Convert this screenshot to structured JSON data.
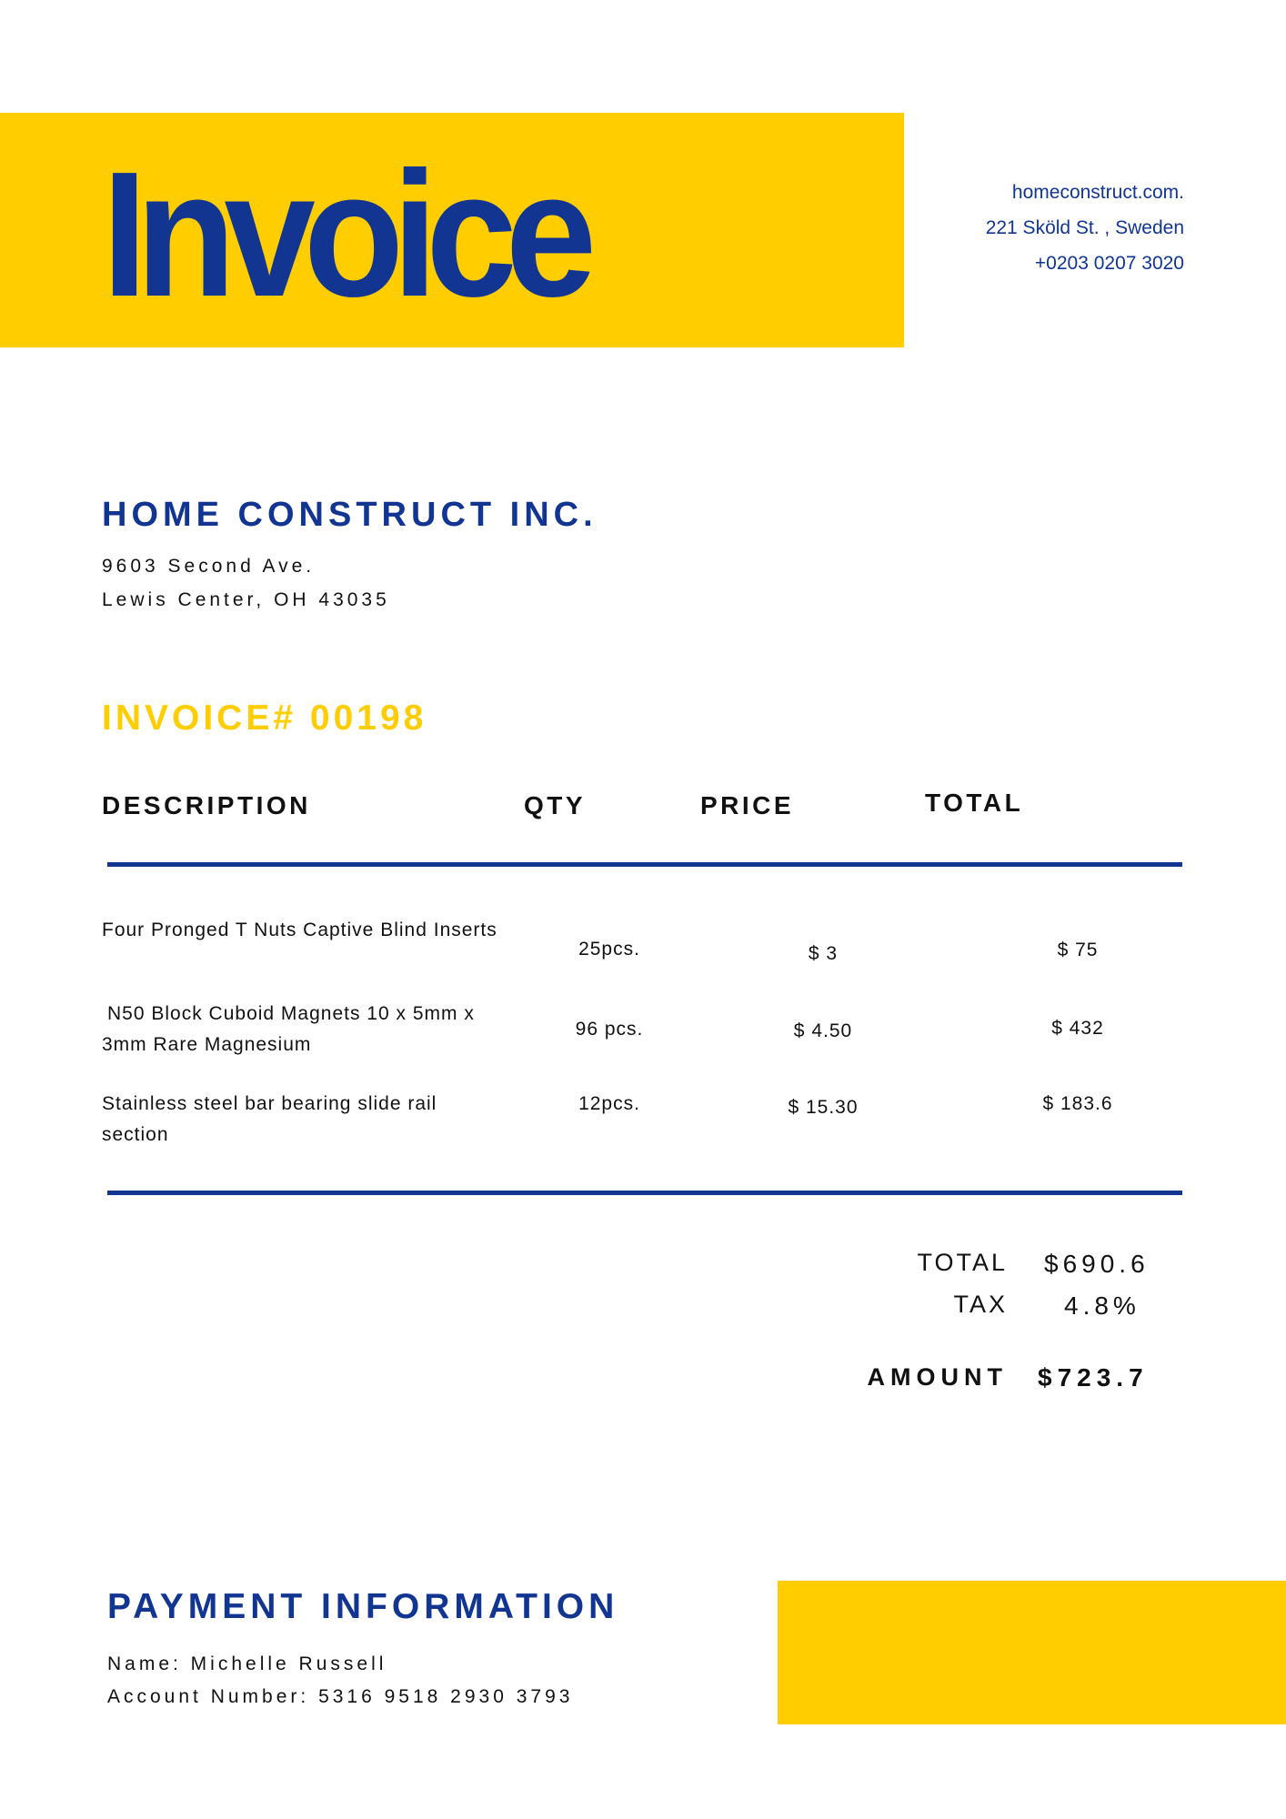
{
  "colors": {
    "accent_yellow": "#FFCD00",
    "brand_blue": "#123592"
  },
  "header": {
    "title": "Invoice",
    "contact": [
      "homeconstruct.com.",
      "221 Sköld St. , Sweden",
      "+0203 0207 3020"
    ]
  },
  "company": {
    "name": "HOME CONSTRUCT INC.",
    "address": [
      "9603 Second Ave.",
      "Lewis Center, OH 43035"
    ]
  },
  "invoice_number": "INVOICE# 00198",
  "table": {
    "headers": [
      "DESCRIPTION",
      "QTY",
      "PRICE",
      "TOTAL"
    ],
    "rows": [
      {
        "description": "Four Pronged T Nuts Captive Blind Inserts",
        "qty": "25pcs.",
        "price": "$ 3",
        "total": "$ 75"
      },
      {
        "description": "N50 Block Cuboid Magnets 10 x 5mm x 3mm Rare Magnesium",
        "qty": "96 pcs.",
        "price": "$ 4.50",
        "total": "$ 432"
      },
      {
        "description": "Stainless steel bar bearing slide rail section",
        "qty": "12pcs.",
        "price": "$ 15.30",
        "total": "$ 183.6"
      }
    ]
  },
  "summary": {
    "total_label": "TOTAL",
    "total_value": "$690.6",
    "tax_label": "TAX",
    "tax_value": "4.8%",
    "amount_label": "AMOUNT",
    "amount_value": "$723.7"
  },
  "payment": {
    "title": "PAYMENT INFORMATION",
    "name": "Name: Michelle Russell",
    "account": "Account Number: 5316 9518 2930 3793"
  }
}
